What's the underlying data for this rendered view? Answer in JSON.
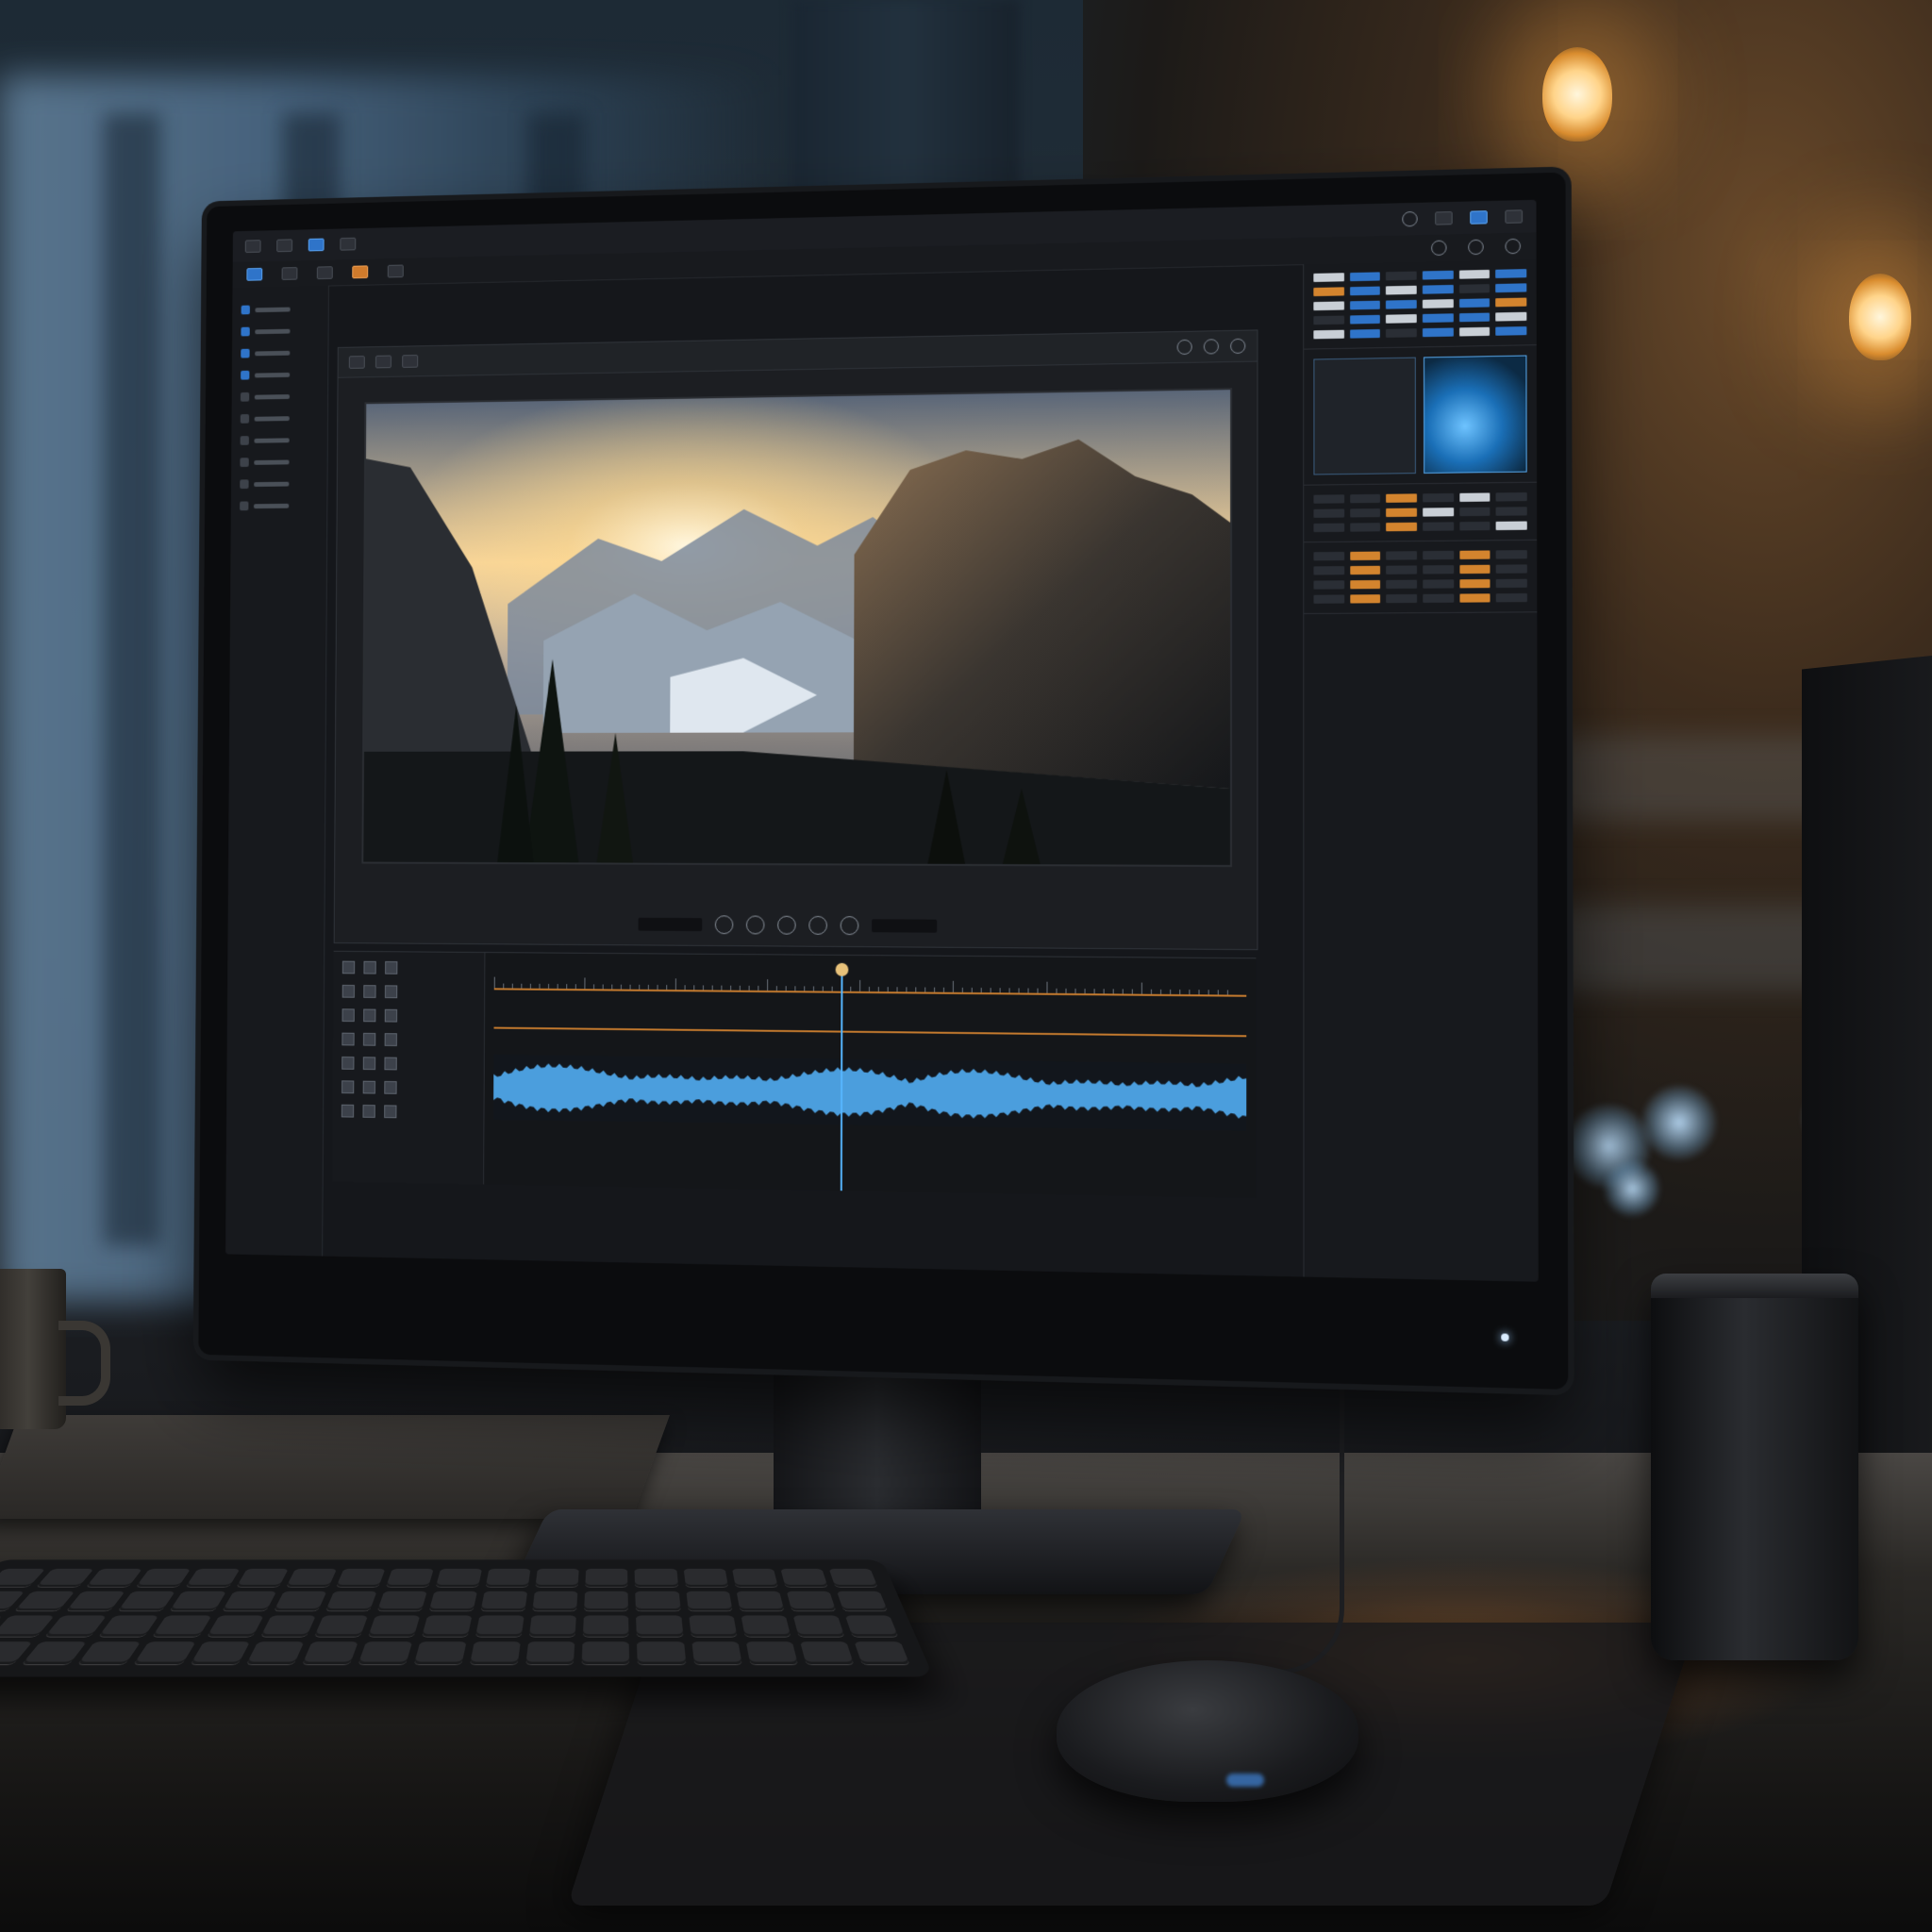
{
  "scene": {
    "description_subject": "editing-workstation",
    "colors": {
      "accent_blue": "#2f74c9",
      "accent_orange": "#d07b2c",
      "warm_light": "#ffd48a",
      "screen_bg": "#15171b"
    }
  },
  "screen": {
    "viewer": {
      "transport_icons": [
        "rewind-icon",
        "play-icon",
        "pause-icon",
        "stop-icon",
        "forward-icon"
      ]
    },
    "timeline": {
      "audio_color": "#56b6ff"
    }
  }
}
